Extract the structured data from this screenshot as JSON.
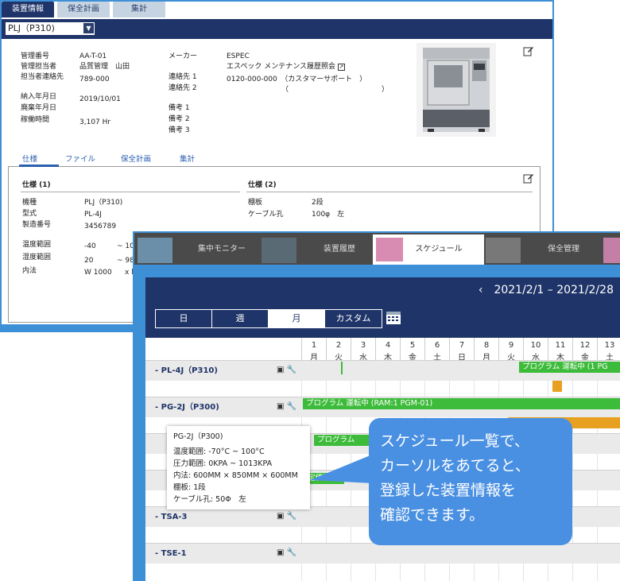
{
  "win1": {
    "tabs": [
      "装置情報",
      "保全計画",
      "集計"
    ],
    "selector": "PLJ（P310)",
    "left_fields": [
      {
        "label": "管理番号",
        "value": "AA-T-01"
      },
      {
        "label": "管理担当者",
        "value": "品質管理　山田"
      },
      {
        "label": "担当者連絡先",
        "value": "789-000"
      },
      {
        "label": "納入年月日",
        "value": "2019/10/01"
      },
      {
        "label": "廃棄年月日",
        "value": ""
      },
      {
        "label": "稼働時間",
        "value": "3,107 Hr"
      }
    ],
    "maker_label": "メーカー",
    "maker": "ESPEC",
    "maker_sub": "エスペック メンテナンス履歴照会",
    "contact1_label": "連絡先 1",
    "contact1": "0120-000-000　（カスタマーサポート　）",
    "contact2_label": "連絡先 2",
    "contact2": "（　　　　　　　　　　　　　）",
    "notes": [
      "備考 1",
      "備考 2",
      "備考 3"
    ],
    "subtabs": [
      "仕様",
      "ファイル",
      "保全計画",
      "集計"
    ],
    "spec1_title": "仕様 (1)",
    "spec2_title": "仕様 (2)",
    "spec1": [
      {
        "label": "機種",
        "value": "PLJ（P310)"
      },
      {
        "label": "型式",
        "value": "PL-4J"
      },
      {
        "label": "製造番号",
        "value": "3456789"
      }
    ],
    "spec1b": [
      {
        "label": "温度範囲",
        "value": "-40",
        "value2": "~ 10"
      },
      {
        "label": "湿度範囲",
        "value": "20",
        "value2": "~ 98"
      },
      {
        "label": "内法",
        "value": "W  1000",
        "value2": "x l"
      }
    ],
    "spec2": [
      {
        "label": "棚板",
        "value": "2段"
      },
      {
        "label": "ケーブル孔",
        "value": "100φ　左"
      }
    ]
  },
  "win2": {
    "tabs": [
      "集中モニター",
      "装置履歴",
      "スケジュール",
      "保全管理"
    ],
    "date_range": "2021/2/1 – 2021/2/28",
    "prev": "‹",
    "views": [
      "日",
      "週",
      "月",
      "カスタム"
    ],
    "days": [
      {
        "d": "1",
        "w": "月"
      },
      {
        "d": "2",
        "w": "火"
      },
      {
        "d": "3",
        "w": "水"
      },
      {
        "d": "4",
        "w": "木"
      },
      {
        "d": "5",
        "w": "金"
      },
      {
        "d": "6",
        "w": "土"
      },
      {
        "d": "7",
        "w": "日"
      },
      {
        "d": "8",
        "w": "月"
      },
      {
        "d": "9",
        "w": "火"
      },
      {
        "d": "10",
        "w": "水"
      },
      {
        "d": "11",
        "w": "木"
      },
      {
        "d": "12",
        "w": "金"
      },
      {
        "d": "13",
        "w": "土"
      }
    ],
    "rows": [
      "PL-4J（P310)",
      "PG-2J（P300)",
      "",
      "",
      "TSA-3",
      "TSE-1"
    ],
    "bar1": "プログラム 運転中 (1 PG",
    "bar2": "プログラム 運転中 (RAM:1 PGM-01)",
    "bar3": "プログラム",
    "bar4": "定値運..",
    "tooltip": [
      "PG-2J（P300)",
      "温度範囲: -70°C ~ 100°C",
      "圧力範囲: 0KPA ~ 1013KPA",
      "内法: 600MM × 850MM × 600MM",
      "棚板: 1段",
      "ケーブル孔: 50Φ　左"
    ]
  },
  "callout": [
    "スケジュール一覧で、",
    "カーソルをあてると、",
    "登録した装置情報を",
    "確認できます。"
  ]
}
